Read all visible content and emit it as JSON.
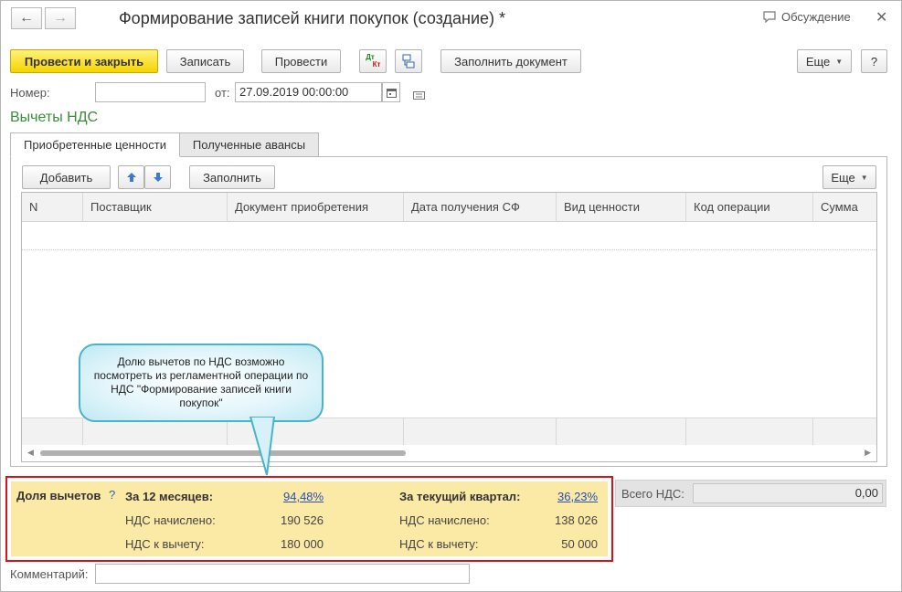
{
  "window": {
    "title": "Формирование записей книги покупок (создание) *",
    "discuss_label": "Обсуждение"
  },
  "toolbar": {
    "post_close": "Провести и закрыть",
    "save": "Записать",
    "post": "Провести",
    "dtkt_top": "Дт",
    "dtkt_bottom": "Кт",
    "fill_document": "Заполнить документ",
    "more": "Еще",
    "help": "?"
  },
  "form": {
    "number_label": "Номер:",
    "number_value": "",
    "date_label": "от:",
    "date_value": "27.09.2019 00:00:00",
    "section_title": "Вычеты НДС"
  },
  "tabs": [
    {
      "label": "Приобретенные ценности",
      "active": true
    },
    {
      "label": "Полученные авансы",
      "active": false
    }
  ],
  "table_toolbar": {
    "add": "Добавить",
    "fill": "Заполнить",
    "more": "Еще"
  },
  "table": {
    "columns": [
      "N",
      "Поставщик",
      "Документ приобретения",
      "Дата получения СФ",
      "Вид ценности",
      "Код операции",
      "Сумма"
    ]
  },
  "callout": {
    "text": "Долю вычетов по НДС возможно посмотреть из регламентной операции по НДС \"Формирование записей книги покупок\""
  },
  "vat_share": {
    "label": "Доля вычетов",
    "help": "?",
    "period12_label": "За 12 месяцев:",
    "period12_percent": "94,48%",
    "quarter_label": "За текущий квартал:",
    "quarter_percent": "36,23%",
    "accrued_label": "НДС начислено:",
    "accrued_12": "190 526",
    "accrued_quarter": "138 026",
    "deduct_label": "НДС к вычету:",
    "deduct_12": "180 000",
    "deduct_quarter": "50 000"
  },
  "total": {
    "label": "Всего НДС:",
    "value": "0,00"
  },
  "comment": {
    "label": "Комментарий:",
    "value": ""
  },
  "colors": {
    "primary_button": "#f5d400",
    "section_title": "#3a8c3a",
    "highlight_border": "#d7141a",
    "vat_panel_bg": "#fbe9a6",
    "link": "#2a4fb0"
  }
}
